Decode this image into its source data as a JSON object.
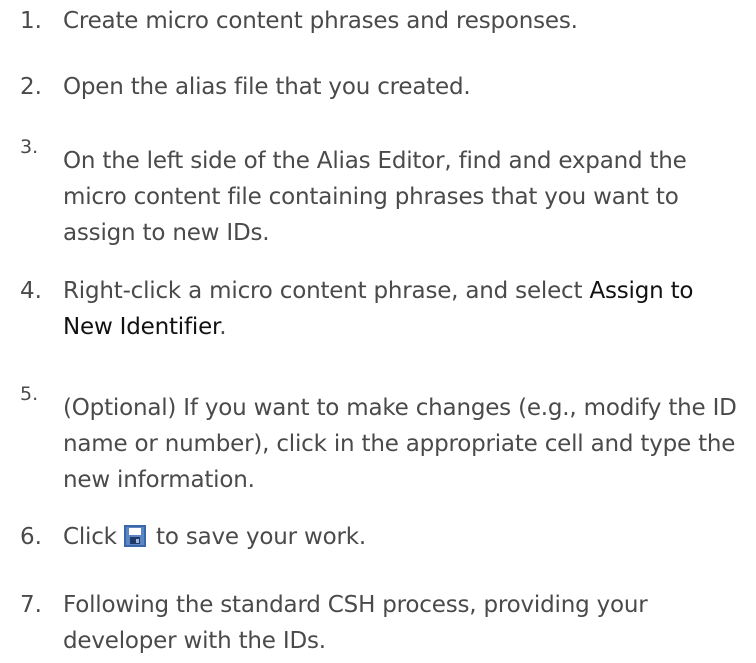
{
  "steps": [
    {
      "number": "1.",
      "text": "Create micro content phrases and responses."
    },
    {
      "number": "2.",
      "text": "Open the alias file that you created."
    },
    {
      "number": "3.",
      "text": "On the left side of the Alias Editor, find and expand the micro content file containing phrases that you want to assign to new IDs."
    },
    {
      "number": "4.",
      "text_before": "Right-click a micro content phrase, and select ",
      "ui_label": "Assign to New Identifier",
      "text_after": "."
    },
    {
      "number": "5.",
      "text": "(Optional) If you want to make changes (e.g., modify the ID name or number), click in the appropriate cell and type the new information."
    },
    {
      "number": "6.",
      "text_before": "Click ",
      "icon": "save-icon",
      "text_after": " to save your work."
    },
    {
      "number": "7.",
      "text": "Following the standard CSH process, providing your developer with the IDs."
    }
  ],
  "colors": {
    "body_text": "#4a4a4a",
    "ui_label_text": "#111111",
    "save_icon_blue": "#5c86c4"
  }
}
